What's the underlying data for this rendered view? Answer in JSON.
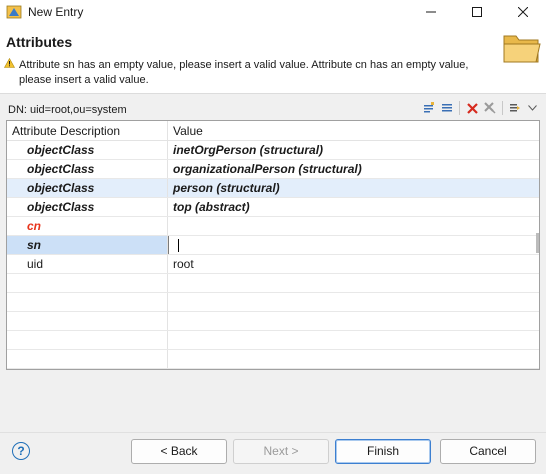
{
  "window": {
    "title": "New Entry",
    "controls": [
      "minimize-icon",
      "maximize-icon",
      "close-icon"
    ]
  },
  "header": {
    "title": "Attributes",
    "message": "Attribute sn has an empty value, please insert a valid value. Attribute cn has an empty value, please insert a valid value.",
    "warning_icon": "warning-icon",
    "banner_icon": "folder-icon"
  },
  "dn": "DN: uid=root,ou=system",
  "toolbar": {
    "icons": [
      "new-attribute-icon",
      "new-value-icon",
      "delete-icon",
      "delete-all-icon",
      "filter-icon",
      "view-menu-icon"
    ]
  },
  "table": {
    "headers": [
      "Attribute Description",
      "Value"
    ],
    "rows": [
      {
        "attr": "objectClass",
        "value": "inetOrgPerson (structural)"
      },
      {
        "attr": "objectClass",
        "value": "organizationalPerson (structural)"
      },
      {
        "attr": "objectClass",
        "value": "person (structural)"
      },
      {
        "attr": "objectClass",
        "value": "top (abstract)"
      },
      {
        "attr": "cn",
        "value": ""
      },
      {
        "attr": "sn",
        "value": ""
      },
      {
        "attr": "uid",
        "value": "root"
      }
    ]
  },
  "buttons": {
    "help": "?",
    "back": "< Back",
    "next": "Next >",
    "finish": "Finish",
    "cancel": "Cancel"
  },
  "colors": {
    "selected_row": "#e3eefb",
    "error_text": "#e8331b",
    "default_button_border": "#3c7fd0"
  }
}
